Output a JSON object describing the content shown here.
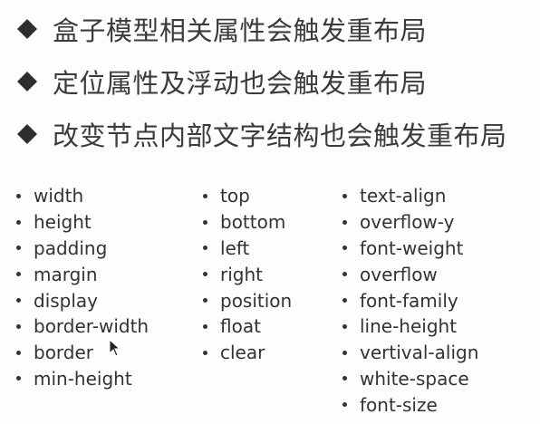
{
  "headings": [
    "盒子模型相关属性会触发重布局",
    "定位属性及浮动也会触发重布局",
    "改变节点内部文字结构也会触发重布局"
  ],
  "columns": [
    [
      "width",
      "height",
      "padding",
      "margin",
      "display",
      "border-width",
      "border",
      "min-height"
    ],
    [
      "top",
      "bottom",
      "left",
      "right",
      "position",
      "float",
      "clear"
    ],
    [
      "text-align",
      "overflow-y",
      "font-weight",
      "overflow",
      "font-family",
      "line-height",
      "vertival-align",
      "white-space",
      "font-size"
    ]
  ],
  "icons": {
    "heading_bullet": "diamond-bullet-icon",
    "list_bullet": "round-bullet-icon",
    "cursor": "mouse-pointer-icon"
  },
  "colors": {
    "background": "#fdfdfd",
    "text": "#333333",
    "diamond": "#2e2e2e"
  }
}
